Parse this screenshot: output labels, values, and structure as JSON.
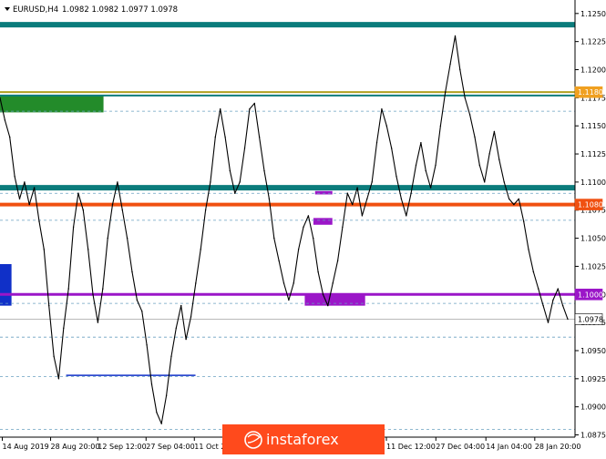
{
  "header": {
    "symbol_label": "EURUSD,H4",
    "ohlc_label": "1.0982 1.0982 1.0977 1.0978"
  },
  "watermark": {
    "text": "instaforex"
  },
  "colors": {
    "price": "#000000",
    "teal_level": "#0b7c7c",
    "orange_level": "#f05010",
    "purple_level": "#9b16c8",
    "olive_level": "#b0a020",
    "green_zone": "#238b2a",
    "blue_zone": "#1030c8",
    "dashed_level": "#6aa0c0",
    "axis_text": "#000000",
    "tag_orange": "#f0a020",
    "tag_red": "#f05010",
    "tag_purple": "#9b16c8",
    "tag_white": "#ffffff",
    "watermark_bg": "#ff4a1c"
  },
  "chart_data": {
    "type": "line",
    "title": "",
    "xlabel": "",
    "ylabel": "",
    "ylim": [
      1.0873,
      1.1262
    ],
    "y_ticks": [
      "1.1250",
      "1.1225",
      "1.1200",
      "1.1175",
      "1.1150",
      "1.1125",
      "1.1100",
      "1.1075",
      "1.1050",
      "1.1025",
      "1.1000",
      "1.0975",
      "1.0950",
      "1.0925",
      "1.0900",
      "1.0875"
    ],
    "x_labels": [
      "14 Aug 2019",
      "28 Aug 20:00",
      "12 Sep 12:00",
      "27 Sep 04:00",
      "11 Oct 2",
      "11 Dec 12:00",
      "27 Dec 04:00",
      "14 Jan 04:00",
      "28 Jan 20:00"
    ],
    "series": [
      {
        "values": [
          1.1175,
          1.1155,
          1.114,
          1.1105,
          1.1085,
          1.11,
          1.108,
          1.1095,
          1.1065,
          1.104,
          1.099,
          1.0945,
          1.0925,
          1.097,
          1.1005,
          1.106,
          1.109,
          1.1075,
          1.104,
          1.1,
          1.0975,
          1.1005,
          1.105,
          1.108,
          1.11,
          1.1075,
          1.105,
          1.102,
          1.0995,
          1.0985,
          1.0955,
          1.092,
          1.0895,
          1.0885,
          1.091,
          1.0945,
          1.097,
          1.099,
          1.096,
          1.098,
          1.101,
          1.104,
          1.1075,
          1.11,
          1.114,
          1.1165,
          1.114,
          1.111,
          1.109,
          1.11,
          1.113,
          1.1165,
          1.117,
          1.114,
          1.111,
          1.1085,
          1.105,
          1.103,
          1.101,
          1.0995,
          1.101,
          1.104,
          1.106,
          1.107,
          1.105,
          1.102,
          1.1,
          1.099,
          1.101,
          1.103,
          1.106,
          1.109,
          1.108,
          1.1095,
          1.107,
          1.1085,
          1.11,
          1.1135,
          1.1165,
          1.115,
          1.113,
          1.1105,
          1.1085,
          1.107,
          1.109,
          1.1115,
          1.1135,
          1.111,
          1.1095,
          1.1115,
          1.115,
          1.118,
          1.1205,
          1.123,
          1.12,
          1.1175,
          1.116,
          1.114,
          1.1115,
          1.11,
          1.1125,
          1.1145,
          1.112,
          1.11,
          1.1085,
          1.108,
          1.1085,
          1.1065,
          1.104,
          1.102,
          1.1005,
          1.099,
          1.0975,
          1.0995,
          1.1005,
          1.099,
          1.0978
        ]
      }
    ],
    "levels": [
      {
        "value": 1.124,
        "style": "teal_thick"
      },
      {
        "value": 1.118,
        "style": "olive",
        "label": "1.1180"
      },
      {
        "value": 1.1177,
        "style": "teal_thin"
      },
      {
        "value": 1.1095,
        "style": "teal_thick"
      },
      {
        "value": 1.108,
        "style": "orange",
        "label": "1.1080"
      },
      {
        "value": 1.1,
        "style": "purple",
        "label": "1.1000"
      },
      {
        "value": 1.0978,
        "style": "current",
        "label": "1.0978"
      }
    ],
    "dashed_levels": [
      1.1163,
      1.109,
      1.1066,
      1.0992,
      1.0962,
      1.0927,
      1.088
    ],
    "zones": [
      {
        "name": "green",
        "y_top": 1.1177,
        "y_bottom": 1.1162,
        "x0": 0.0,
        "x1": 0.18
      },
      {
        "name": "blue",
        "y_top": 1.1027,
        "y_bottom": 1.099,
        "x0": 0.0,
        "x1": 0.02
      },
      {
        "name": "purple-large",
        "y_top": 1.1,
        "y_bottom": 1.099,
        "x0": 0.53,
        "x1": 0.635
      },
      {
        "name": "purple-mid",
        "y_top": 1.1068,
        "y_bottom": 1.1062,
        "x0": 0.545,
        "x1": 0.578
      },
      {
        "name": "purple-small",
        "y_top": 1.1092,
        "y_bottom": 1.1089,
        "x0": 0.548,
        "x1": 0.578
      }
    ],
    "support_segment": {
      "value": 1.0928,
      "x0": 0.115,
      "x1": 0.34
    }
  }
}
